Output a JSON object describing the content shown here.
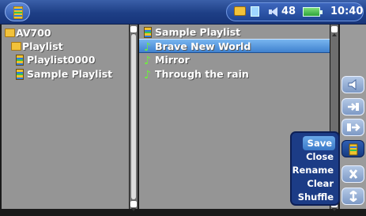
{
  "status": {
    "volume": "48",
    "time": "10:40"
  },
  "left_pane": {
    "items": [
      {
        "label": "AV700",
        "icon": "folder-icon"
      },
      {
        "label": "Playlist",
        "icon": "folder-icon"
      },
      {
        "label": "Playlist0000",
        "icon": "playlist-icon"
      },
      {
        "label": "Sample Playlist",
        "icon": "playlist-icon"
      }
    ]
  },
  "mid_pane": {
    "header": "Sample Playlist",
    "tracks": [
      {
        "label": "Brave New World",
        "selected": true
      },
      {
        "label": "Mirror",
        "selected": false
      },
      {
        "label": "Through the rain",
        "selected": false
      }
    ]
  },
  "menu": {
    "items": [
      {
        "label": "Save",
        "highlighted": true
      },
      {
        "label": "Close",
        "highlighted": false
      },
      {
        "label": "Rename",
        "highlighted": false
      },
      {
        "label": "Clear",
        "highlighted": false
      },
      {
        "label": "Shuffle",
        "highlighted": false
      }
    ]
  },
  "toolbar": {
    "icons": [
      "speaker-icon",
      "add-to-playlist-icon",
      "insert-icon",
      "playlist-icon",
      "delete-icon",
      "move-icon"
    ]
  },
  "colors": {
    "topbar": "#1e3f86",
    "selection": "#4f8fd8",
    "menu": "#1c3c86"
  }
}
